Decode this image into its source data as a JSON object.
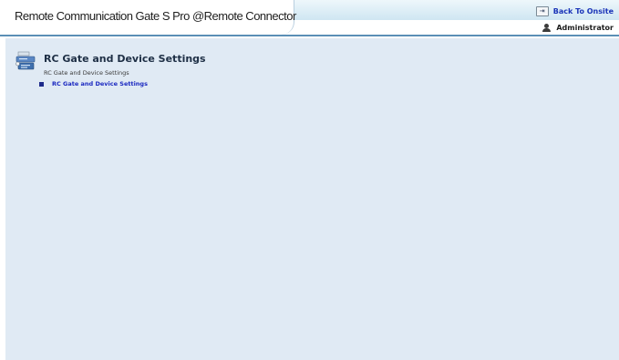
{
  "header": {
    "app_title": "Remote Communication Gate S Pro @Remote Connector",
    "back_link_label": "Back To Onsite",
    "user_name": "Administrator"
  },
  "icons": {
    "back": "exit-door-icon",
    "user": "user-icon",
    "section": "settings-device-icon",
    "bullet": "square-bullet-icon"
  },
  "colors": {
    "content_background": "#e0eaf4",
    "header_rule": "#5b8fb6",
    "link": "#1a28c0"
  },
  "section": {
    "title": "RC Gate and Device Settings",
    "subtitle": "RC Gate and Device Settings",
    "menu_items": [
      {
        "label": "RC Gate and Device Settings"
      }
    ]
  }
}
